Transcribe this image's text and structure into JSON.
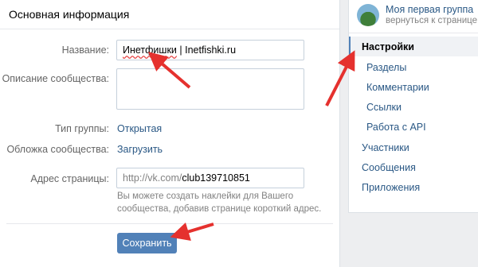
{
  "main": {
    "title": "Основная информация",
    "name_label": "Название:",
    "name_value_part1": "Инетфишки",
    "name_value_part2": " | Inetfishki.ru",
    "description_label": "Описание сообщества:",
    "description_value": "",
    "type_label": "Тип группы:",
    "type_value": "Открытая",
    "cover_label": "Обложка сообщества:",
    "cover_value": "Загрузить",
    "address_label": "Адрес страницы:",
    "address_prefix": "http://vk.com/",
    "address_value": "club139710851",
    "address_hint": "Вы можете создать наклейки для Вашего сообщества, добавив странице короткий адрес.",
    "save_label": "Сохранить"
  },
  "side": {
    "group_name": "Моя первая группа",
    "group_back": "вернуться к странице",
    "nav": [
      {
        "label": "Настройки",
        "active": true
      },
      {
        "label": "Разделы"
      },
      {
        "label": "Комментарии"
      },
      {
        "label": "Ссылки"
      },
      {
        "label": "Работа с API"
      },
      {
        "label": "Участники"
      },
      {
        "label": "Сообщения"
      },
      {
        "label": "Приложения"
      }
    ]
  },
  "colors": {
    "accent": "#5181b8",
    "link": "#2a5885",
    "arrow": "#e5312e"
  },
  "icons": [
    "group-avatar-icon",
    "red-arrow-icon"
  ]
}
